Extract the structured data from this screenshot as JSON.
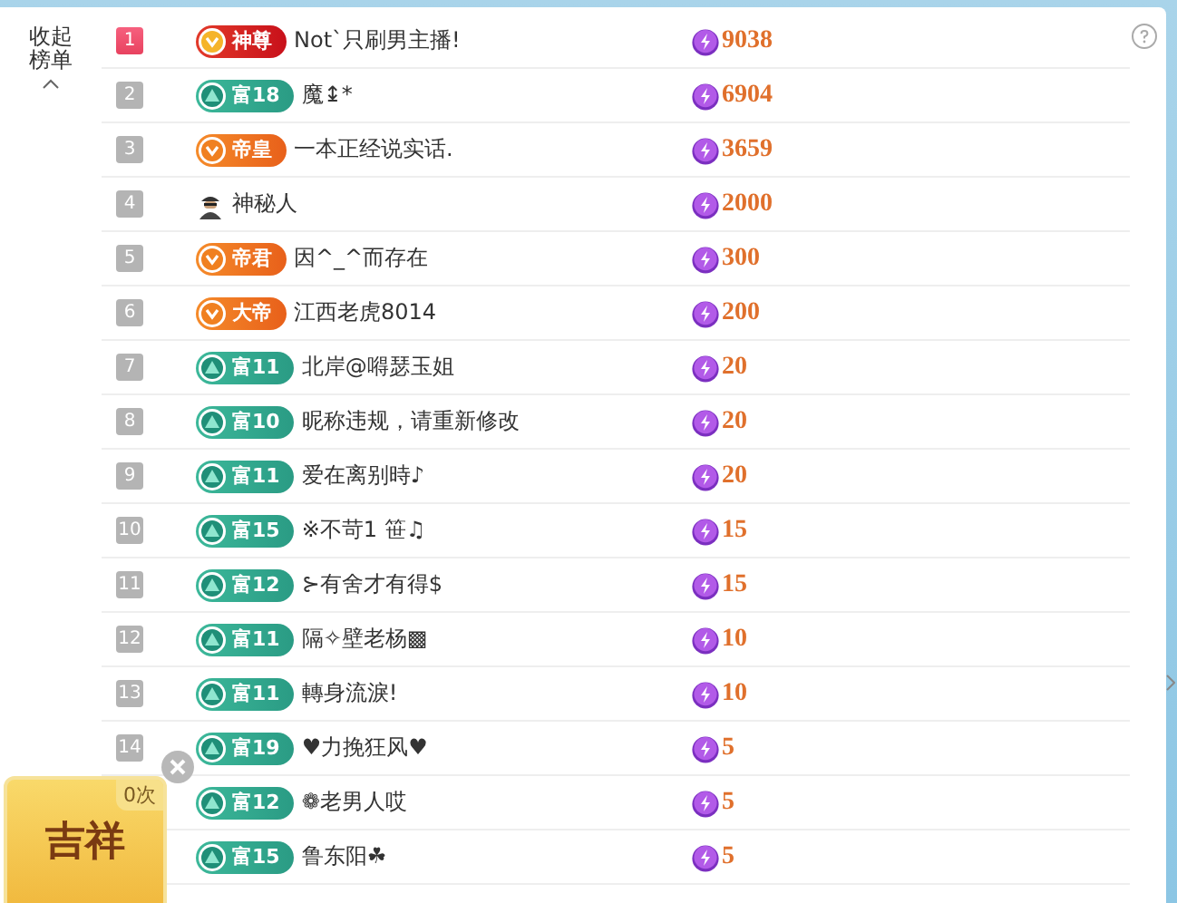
{
  "sidebar": {
    "collapse_label": "收起榜单"
  },
  "rows": [
    {
      "rank": "1",
      "top": true,
      "badge": {
        "kind": "deity",
        "label": "神尊"
      },
      "name": "Not`只刷男主播!",
      "value": "9038"
    },
    {
      "rank": "2",
      "top": false,
      "badge": {
        "kind": "wealth",
        "label": "富18"
      },
      "name": "魔↨*",
      "value": "6904"
    },
    {
      "rank": "3",
      "top": false,
      "badge": {
        "kind": "noble",
        "label": "帝皇"
      },
      "name": "一本正经说实话.",
      "value": "3659"
    },
    {
      "rank": "4",
      "top": false,
      "badge": {
        "kind": "mystery"
      },
      "name": "神秘人",
      "value": "2000"
    },
    {
      "rank": "5",
      "top": false,
      "badge": {
        "kind": "noble",
        "label": "帝君"
      },
      "name": "因^_^而存在",
      "value": "300"
    },
    {
      "rank": "6",
      "top": false,
      "badge": {
        "kind": "noble",
        "label": "大帝"
      },
      "name": "江西老虎8014",
      "value": "200"
    },
    {
      "rank": "7",
      "top": false,
      "badge": {
        "kind": "wealth",
        "label": "富11"
      },
      "name": "北岸@嘚瑟玉姐",
      "value": "20"
    },
    {
      "rank": "8",
      "top": false,
      "badge": {
        "kind": "wealth",
        "label": "富10"
      },
      "name": "昵称违规，请重新修改",
      "value": "20"
    },
    {
      "rank": "9",
      "top": false,
      "badge": {
        "kind": "wealth",
        "label": "富11"
      },
      "name": "爱在离别時♪",
      "value": "20"
    },
    {
      "rank": "10",
      "top": false,
      "badge": {
        "kind": "wealth",
        "label": "富15"
      },
      "name": "※不苛1 笹♫",
      "value": "15"
    },
    {
      "rank": "11",
      "top": false,
      "badge": {
        "kind": "wealth",
        "label": "富12"
      },
      "name": "⊱有舍才有得$",
      "value": "15"
    },
    {
      "rank": "12",
      "top": false,
      "badge": {
        "kind": "wealth",
        "label": "富11"
      },
      "name": "隔✧壁老杨▩",
      "value": "10"
    },
    {
      "rank": "13",
      "top": false,
      "badge": {
        "kind": "wealth",
        "label": "富11"
      },
      "name": "轉身流淚!",
      "value": "10"
    },
    {
      "rank": "14",
      "top": false,
      "badge": {
        "kind": "wealth",
        "label": "富19"
      },
      "name": "♥力挽狂风♥",
      "value": "5"
    },
    {
      "badge": {
        "kind": "wealth",
        "label": "富12"
      },
      "name": "❁老男人哎",
      "value": "5"
    },
    {
      "badge": {
        "kind": "wealth",
        "label": "富15"
      },
      "name": "鲁东阳☘",
      "value": "5"
    }
  ],
  "lucky_card": {
    "count": "0次",
    "label": "吉祥"
  }
}
